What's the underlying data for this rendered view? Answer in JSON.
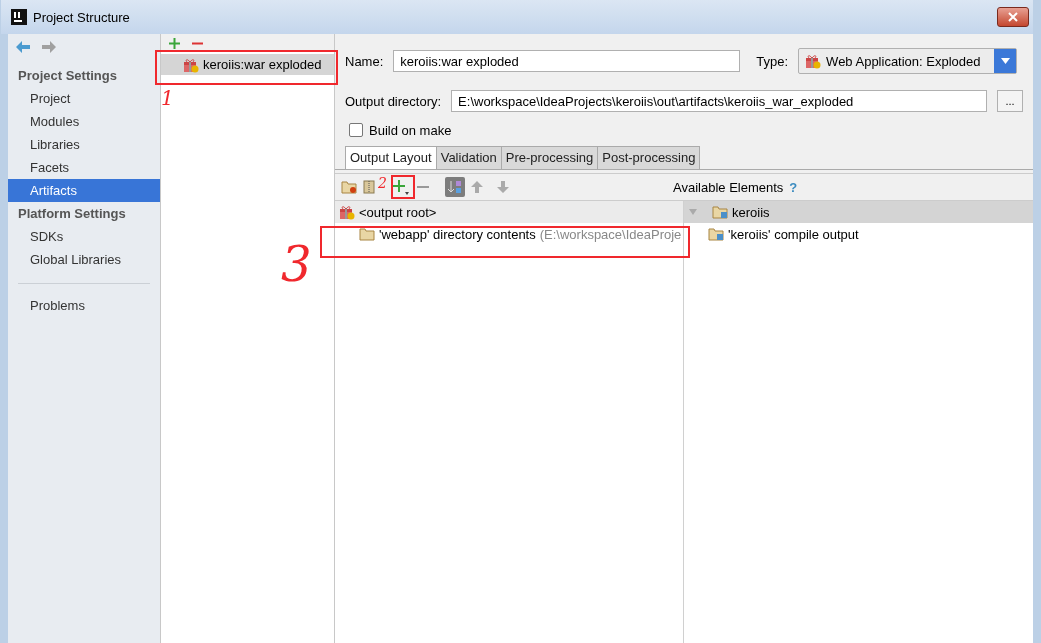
{
  "window": {
    "title": "Project Structure"
  },
  "sidebar": {
    "sections": [
      {
        "heading": "Project Settings",
        "items": [
          {
            "label": "Project",
            "selected": false
          },
          {
            "label": "Modules",
            "selected": false
          },
          {
            "label": "Libraries",
            "selected": false
          },
          {
            "label": "Facets",
            "selected": false
          },
          {
            "label": "Artifacts",
            "selected": true
          }
        ]
      },
      {
        "heading": "Platform Settings",
        "items": [
          {
            "label": "SDKs",
            "selected": false
          },
          {
            "label": "Global Libraries",
            "selected": false
          }
        ]
      },
      {
        "items": [
          {
            "label": "Problems",
            "selected": false
          }
        ]
      }
    ]
  },
  "artifacts": [
    {
      "label": "keroiis:war exploded",
      "selected": true
    }
  ],
  "name_field": {
    "label": "Name:",
    "value": "keroiis:war exploded"
  },
  "type_field": {
    "label": "Type:",
    "value": "Web Application: Exploded"
  },
  "output_directory": {
    "label": "Output directory:",
    "value": "E:\\workspace\\IdeaProjects\\keroiis\\out\\artifacts\\keroiis_war_exploded",
    "browse": "..."
  },
  "build_on_make": {
    "label": "Build on make",
    "checked": false
  },
  "tabs": [
    {
      "label": "Output Layout",
      "selected": true
    },
    {
      "label": "Validation",
      "selected": false
    },
    {
      "label": "Pre-processing",
      "selected": false
    },
    {
      "label": "Post-processing",
      "selected": false
    }
  ],
  "available_elements": {
    "title": "Available Elements",
    "help": "?"
  },
  "output_tree": [
    {
      "label": "<output root>",
      "kind": "root",
      "selected": true,
      "children": [
        {
          "label": "'webapp' directory contents",
          "detail": "(E:\\workspace\\IdeaProje",
          "kind": "folder",
          "selected": false
        }
      ]
    }
  ],
  "available_tree": [
    {
      "label": "keroiis",
      "kind": "module",
      "expanded": true,
      "selected": true,
      "children": [
        {
          "label": "'keroiis' compile output",
          "kind": "module",
          "selected": false
        }
      ]
    }
  ],
  "annotations": [
    {
      "label": "1"
    },
    {
      "label": "2"
    },
    {
      "label": "3"
    }
  ]
}
